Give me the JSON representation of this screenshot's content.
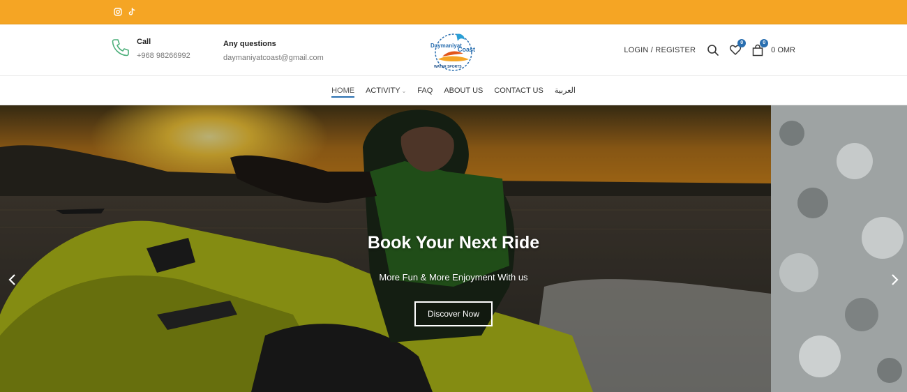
{
  "topbar": {
    "social": [
      "instagram-icon",
      "tiktok-icon"
    ],
    "color": "#f5a524"
  },
  "header": {
    "call": {
      "label": "Call",
      "value": "+968 98266992"
    },
    "questions": {
      "label": "Any questions",
      "value": "daymaniyatcoast@gmail.com"
    },
    "logo": {
      "line1": "Daymaniyat",
      "line2": "Coast",
      "line3": "WATER SPORTS"
    },
    "login": "LOGIN / REGISTER",
    "wishlist_count": "0",
    "cart_count": "0",
    "cart_total": "0 OMR",
    "accent": "#2a6fb0"
  },
  "nav": {
    "items": [
      {
        "label": "HOME",
        "active": true
      },
      {
        "label": "ACTIVITY",
        "dropdown": true
      },
      {
        "label": "FAQ"
      },
      {
        "label": "ABOUT US"
      },
      {
        "label": "CONTACT US"
      },
      {
        "label": "العربية"
      }
    ]
  },
  "hero": {
    "title": "Book Your Next Ride",
    "subtitle": "More Fun & More Enjoyment With us",
    "button": "Discover Now"
  }
}
